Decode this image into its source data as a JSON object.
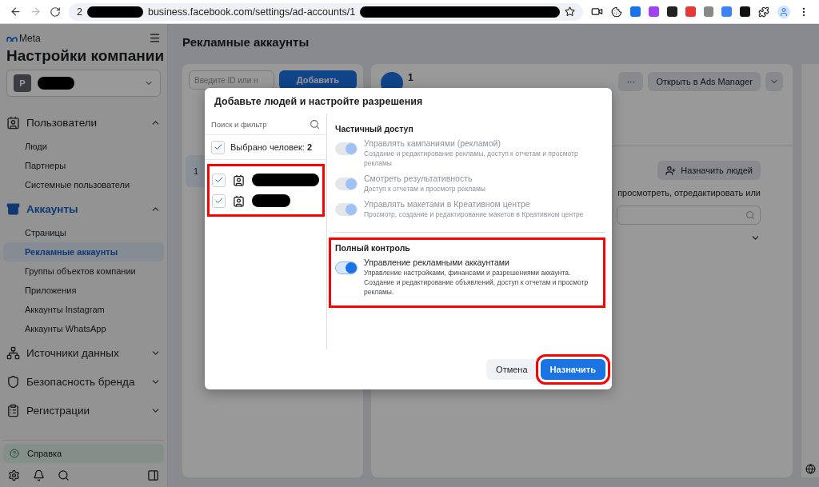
{
  "browser": {
    "url_prefix": "2",
    "url": "business.facebook.com/settings/ad-accounts/1"
  },
  "sidebar": {
    "brand": "Meta",
    "title": "Настройки компании",
    "business": {
      "initial": "P"
    },
    "sections": [
      {
        "label": "Пользователи",
        "active": false,
        "expanded": true,
        "children": [
          {
            "label": "Люди",
            "selected": false
          },
          {
            "label": "Партнеры",
            "selected": false
          },
          {
            "label": "Системные пользователи",
            "selected": false
          }
        ]
      },
      {
        "label": "Аккаунты",
        "active": true,
        "expanded": true,
        "children": [
          {
            "label": "Страницы",
            "selected": false
          },
          {
            "label": "Рекламные аккаунты",
            "selected": true
          },
          {
            "label": "Группы объектов компании",
            "selected": false
          },
          {
            "label": "Приложения",
            "selected": false
          },
          {
            "label": "Аккаунты Instagram",
            "selected": false
          },
          {
            "label": "Аккаунты WhatsApp",
            "selected": false
          }
        ]
      },
      {
        "label": "Источники данных",
        "active": false,
        "expanded": false
      },
      {
        "label": "Безопасность бренда",
        "active": false,
        "expanded": false
      },
      {
        "label": "Регистрации",
        "active": false,
        "expanded": false
      }
    ],
    "help": "Справка"
  },
  "page": {
    "title": "Рекламные аккаунты",
    "list_panel": {
      "search": {
        "placeholder": "Введите ID или н"
      },
      "add_button": "Добавить",
      "rows": [
        {
          "label": "1",
          "selected": true
        }
      ]
    },
    "detail_panel": {
      "account_name": "1",
      "more_button": "···",
      "open_button": "Открыть в Ads Manager",
      "assign_button": "Назначить людей",
      "description": "просмотреть, отредактировать или"
    }
  },
  "dialog": {
    "title": "Добавьте людей и настройте разрешения",
    "people": {
      "search": {
        "placeholder": "Поиск и фильтр"
      },
      "select_all": {
        "label": "Выбрано человек: **2**",
        "checked": true
      },
      "annotated": true,
      "items": [
        {
          "checked": true
        },
        {
          "checked": true
        }
      ]
    },
    "sections": [
      {
        "title": "Частичный доступ",
        "annotated": false,
        "permissions": [
          {
            "title": "Управлять кампаниями (рекламой)",
            "description": "Создание и редактирование рекламы, доступ к отчетам и просмотр рекламы",
            "on": true,
            "disabled": true
          },
          {
            "title": "Смотреть результативность",
            "description": "Доступ к отчетам и просмотр рекламы",
            "on": true,
            "disabled": true
          },
          {
            "title": "Управлять макетами в Креативном центре",
            "description": "Просмотр, создание и редактирование макетов в Креативном центре",
            "on": true,
            "disabled": true
          }
        ]
      },
      {
        "title": "Полный контроль",
        "annotated": true,
        "permissions": [
          {
            "title": "Управление рекламными аккаунтами",
            "description": "Управление настройками, финансами и разрешениями аккаунта. Создание и редактирование объявлений, доступ к отчетам и просмотр рекламы.",
            "on": true,
            "disabled": false
          }
        ]
      }
    ],
    "buttons": [
      {
        "label": "Отмена",
        "kind": "secondary",
        "annotated": false
      },
      {
        "label": "Назначить",
        "kind": "primary",
        "annotated": true
      }
    ]
  }
}
